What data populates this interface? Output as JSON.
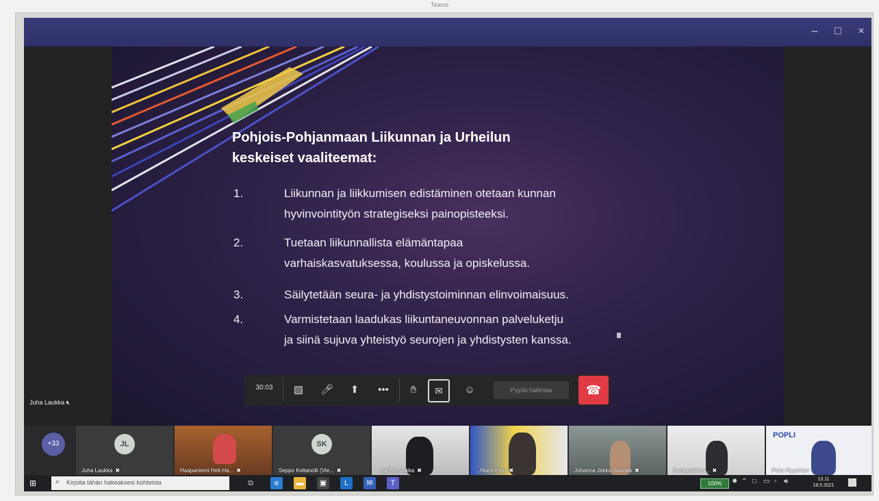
{
  "photo_caption": "Teams",
  "window": {
    "minimize": "–",
    "maximize": "□",
    "close": "×"
  },
  "slide": {
    "title_line1": "Pohjois-Pohjanmaan Liikunnan ja Urheilun",
    "title_line2": "keskeiset vaaliteemat:",
    "items": [
      {
        "num": "1.",
        "line1": "Liikunnan ja liikkumisen edistäminen otetaan kunnan",
        "line2": "hyvinvointityön strategiseksi painopisteeksi."
      },
      {
        "num": "2.",
        "line1": "Tuetaan liikunnallista elämäntapaa",
        "line2": "varhaiskasvatuksessa, koulussa ja opiskelussa."
      },
      {
        "num": "3.",
        "line1": "Säilytetään seura- ja yhdistystoiminnan elinvoimaisuus.",
        "line2": ""
      },
      {
        "num": "4.",
        "line1": "Varmistetaan laadukas liikuntaneuvonnan palveluketju",
        "line2": "ja siinä sujuva yhteistyö seurojen ja yhdistysten kanssa."
      }
    ]
  },
  "presenter": {
    "name": "Juha Laukka"
  },
  "toolbar": {
    "timer": "30:03",
    "request_control": "Pyydä hallintaa",
    "more": "•••"
  },
  "participants": {
    "more_count": "+33",
    "tiles": [
      {
        "initials": "JL",
        "name": "Juha Laukka"
      },
      {
        "initials": "",
        "name": "Haapaniemi Heli-Ha..."
      },
      {
        "initials": "SK",
        "name": "Seppo Keltanolli (Vie..."
      },
      {
        "initials": "",
        "name": "...ial Heli-Jukka"
      },
      {
        "initials": "",
        "name": "...Noen Petri"
      },
      {
        "initials": "",
        "name": "Johanna Jekku-Jauvala"
      },
      {
        "initials": "",
        "name": "Kumpulainen..."
      },
      {
        "initials": "",
        "name": "Peter Ryyninen"
      }
    ],
    "popli_label": "POPLI"
  },
  "taskbar": {
    "search_placeholder": "Kirjoita tähän hakeaksesi kohteista",
    "battery": "100%",
    "time": "13.11",
    "date": "18.5.2021"
  },
  "colors": {
    "titlebar": "#3a3b7a",
    "hangup": "#e23a44",
    "avatar_more": "#5c5ea6"
  }
}
